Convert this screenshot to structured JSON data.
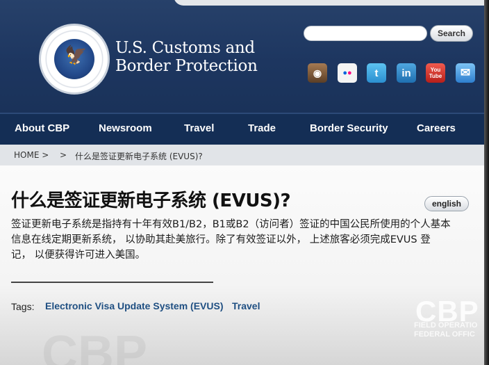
{
  "brand": {
    "line1": "U.S. Customs and",
    "line2": "Border Protection",
    "seal_text": "U.S. DEPARTMENT OF HOMELAND SECURITY"
  },
  "search": {
    "placeholder": "",
    "button_label": "Search"
  },
  "social": [
    {
      "name": "instagram-icon",
      "glyph": "◉",
      "color": "#7b5a3e"
    },
    {
      "name": "flickr-icon",
      "glyph": "●●",
      "color": "#f0f0f0"
    },
    {
      "name": "twitter-icon",
      "glyph": "🐦",
      "color": "#3aa3e3"
    },
    {
      "name": "linkedin-icon",
      "glyph": "in",
      "color": "#2b86c5"
    },
    {
      "name": "youtube-icon",
      "glyph": "You Tube",
      "color": "#d8322a"
    },
    {
      "name": "email-icon",
      "glyph": "✉",
      "color": "#3b8fd8"
    }
  ],
  "nav": {
    "items": [
      "About CBP",
      "Newsroom",
      "Travel",
      "Trade",
      "Border Security",
      "Careers"
    ]
  },
  "breadcrumb": {
    "home": "HOME >",
    "sep": ">",
    "current": "什么是签证更新电子系统 (EVUS)?"
  },
  "main": {
    "title": "什么是签证更新电子系统 (EVUS)?",
    "lang_button": "english",
    "body_line1": "签证更新电子系统是指持有十年有效B1/B2，B1或B2（访问者）签证的中国公民所使用的个人基本",
    "body_line2": "信息在线定期更新系统， 以协助其赴美旅行。除了有效签证以外， 上述旅客必须完成EVUS 登",
    "body_line3": "记， 以便获得许可进入美国。",
    "tags_label": "Tags:",
    "tags": [
      "Electronic Visa Update System (EVUS)",
      "Travel"
    ]
  },
  "watermark": {
    "left": "CBP",
    "right": "CBP",
    "right_sub": "FIELD OPERATIO\nFEDERAL OFFIC"
  },
  "colors": {
    "header_bg": "#1d3660",
    "nav_bg": "#142e55",
    "link": "#1f4f82"
  }
}
